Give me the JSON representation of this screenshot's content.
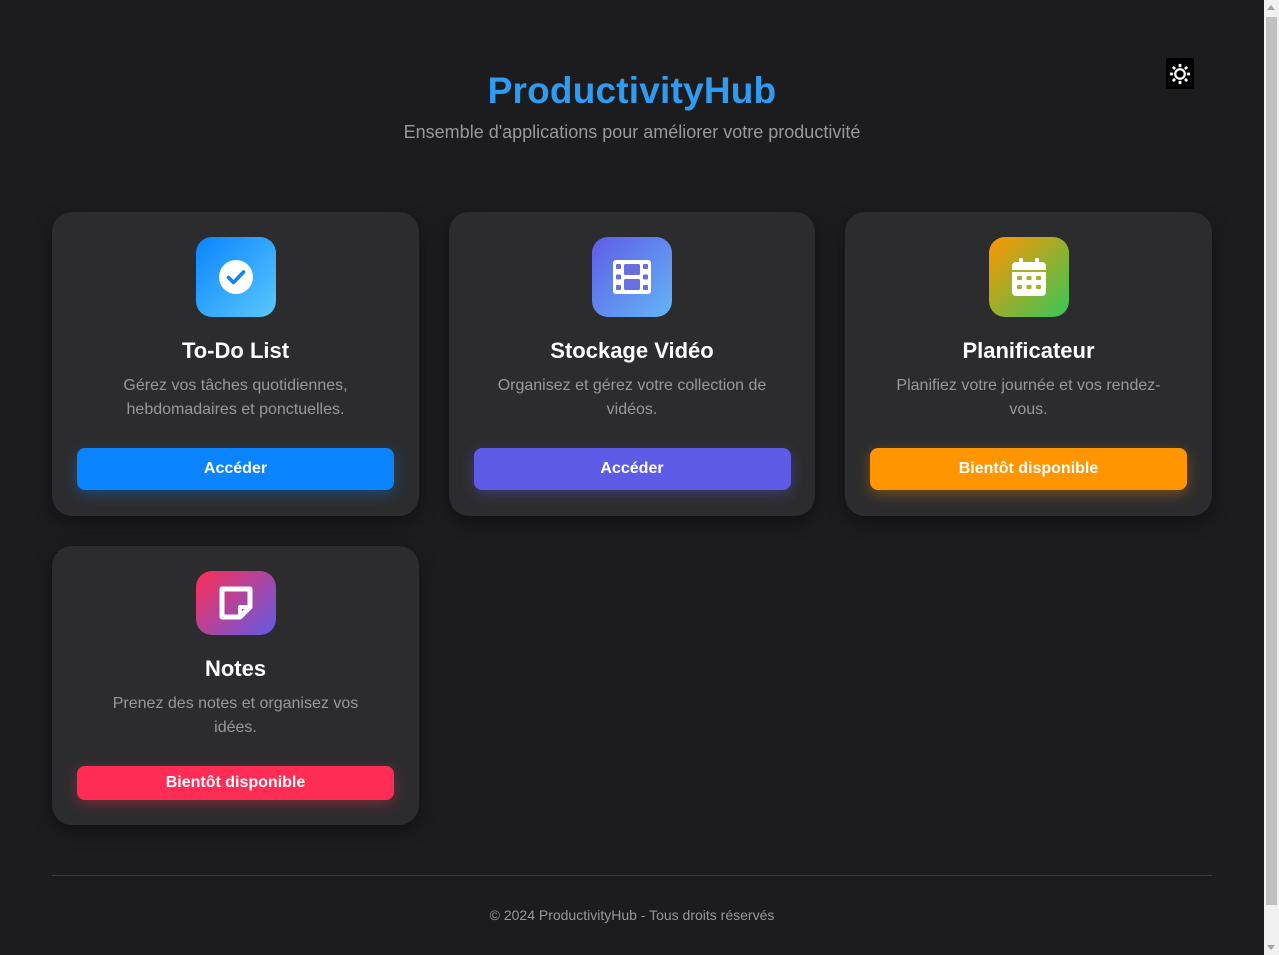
{
  "header": {
    "title": "ProductivityHub",
    "subtitle": "Ensemble d'applications pour améliorer votre productivité"
  },
  "theme_toggle": {
    "icon": "sun-icon"
  },
  "apps": [
    {
      "title": "To-Do List",
      "description": "Gérez vos tâches quotidiennes, hebdomadaires et ponctuelles.",
      "button_label": "Accéder",
      "icon": "check-circle-icon",
      "color": "#0a84ff"
    },
    {
      "title": "Stockage Vidéo",
      "description": "Organisez et gérez votre collection de vidéos.",
      "button_label": "Accéder",
      "icon": "film-icon",
      "color": "#5e5ce6"
    },
    {
      "title": "Planificateur",
      "description": "Planifiez votre journée et vos rendez-vous.",
      "button_label": "Bientôt disponible",
      "icon": "calendar-icon",
      "color": "#ff9500"
    },
    {
      "title": "Notes",
      "description": "Prenez des notes et organisez vos idées.",
      "button_label": "Bientôt disponible",
      "icon": "sticky-note-icon",
      "color": "#ff2d55"
    }
  ],
  "footer": {
    "text": "© 2024 ProductivityHub - Tous droits réservés"
  },
  "colors": {
    "background": "#1c1c1e",
    "card": "#2c2c2e",
    "accent": "#2d9cf2"
  }
}
